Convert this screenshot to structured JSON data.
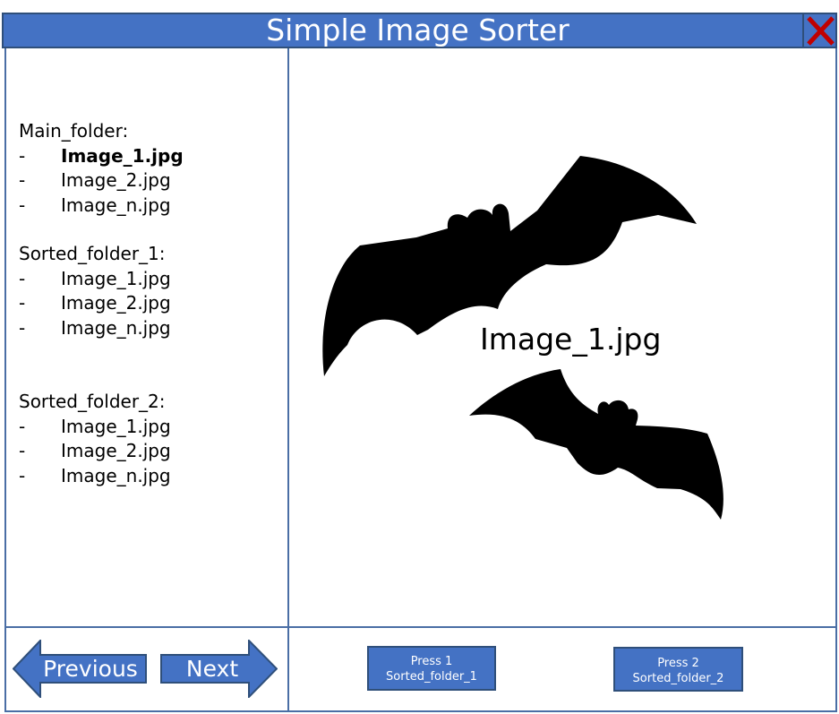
{
  "window": {
    "title": "Simple Image Sorter",
    "close_icon": "close-x-icon",
    "accent_color": "#4472c4",
    "close_color": "#c00000"
  },
  "sidebar": {
    "folders": [
      {
        "name": "Main_folder:",
        "files": [
          {
            "dash": "-",
            "name": "Image_1.jpg",
            "selected": true
          },
          {
            "dash": "-",
            "name": "Image_2.jpg",
            "selected": false
          },
          {
            "dash": "-",
            "name": "Image_n.jpg",
            "selected": false
          }
        ]
      },
      {
        "name": "Sorted_folder_1:",
        "files": [
          {
            "dash": "-",
            "name": "Image_1.jpg"
          },
          {
            "dash": "-",
            "name": "Image_2.jpg"
          },
          {
            "dash": "-",
            "name": "Image_n.jpg"
          }
        ]
      },
      {
        "name": "Sorted_folder_2:",
        "files": [
          {
            "dash": "-",
            "name": "Image_1.jpg"
          },
          {
            "dash": "-",
            "name": "Image_2.jpg"
          },
          {
            "dash": "-",
            "name": "Image_n.jpg"
          }
        ]
      }
    ]
  },
  "preview": {
    "caption": "Image_1.jpg",
    "image_icon": "bats-image"
  },
  "navigation": {
    "previous_label": "Previous",
    "next_label": "Next"
  },
  "sort_buttons": [
    {
      "line1": "Press 1",
      "line2": "Sorted_folder_1"
    },
    {
      "line1": "Press 2",
      "line2": "Sorted_folder_2"
    }
  ]
}
